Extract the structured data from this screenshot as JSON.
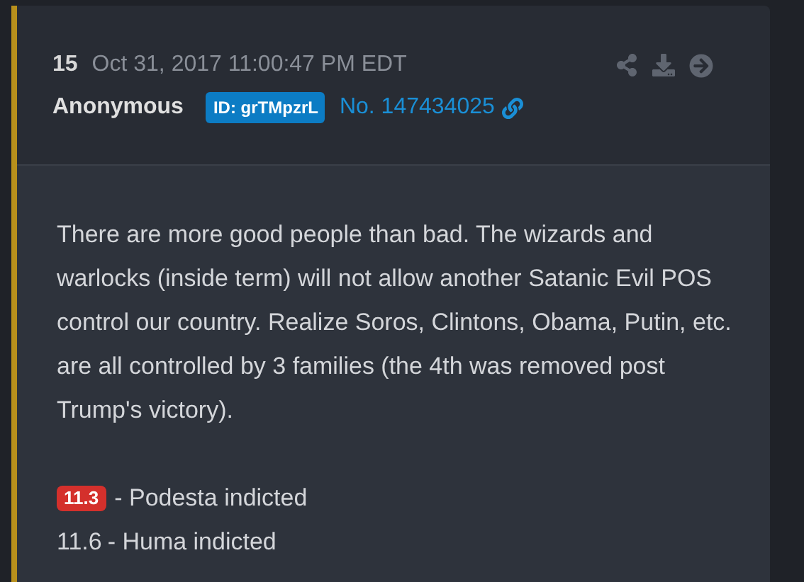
{
  "post": {
    "number": "15",
    "timestamp": "Oct 31, 2017 11:00:47 PM EDT",
    "author": "Anonymous",
    "id_badge": "ID: grTMpzrL",
    "post_no": "No. 147434025",
    "body": "There are more good people than bad. The wizards and warlocks (inside term) will not allow another Satanic Evil POS control our country. Realize Soros, Clintons, Obama, Putin, etc. are all controlled by 3 families (the 4th was removed post Trump's victory).",
    "entries": [
      {
        "date": "11.3",
        "highlighted": true,
        "text": "- Podesta indicted"
      },
      {
        "date": "11.6",
        "highlighted": false,
        "text": "- Huma indicted"
      }
    ]
  }
}
